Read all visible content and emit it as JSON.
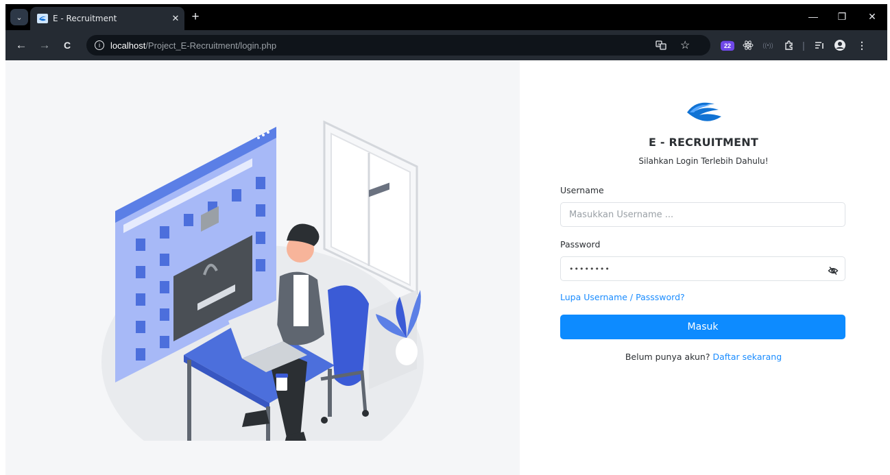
{
  "browser": {
    "tab": {
      "title": "E - Recruitment",
      "close_glyph": "✕"
    },
    "new_tab_glyph": "+",
    "window_controls": {
      "minimize": "—",
      "restore": "❐",
      "close": "✕"
    },
    "nav": {
      "back": "←",
      "forward": "→",
      "reload": "C"
    },
    "address": {
      "host": "localhost",
      "path": "/Project_E-Recruitment/login.php"
    },
    "extension_badge": "22"
  },
  "icons": {
    "tab_search": "chevron-down-icon",
    "favicon": "e-recruitment-logo-icon",
    "site_info": "info-icon",
    "translate": "translate-icon",
    "bookmark": "star-icon",
    "extensions": "puzzle-icon",
    "password_toggle": "eye-slash-icon"
  },
  "login": {
    "app_name": "E - RECRUITMENT",
    "subtitle": "Silahkan Login Terlebih Dahulu!",
    "username_label": "Username",
    "username_placeholder": "Masukkan Username ...",
    "password_label": "Password",
    "password_value": "••••••••",
    "forgot_link": "Lupa Username / Passsword?",
    "submit_label": "Masuk",
    "register_prompt": "Belum punya akun? ",
    "register_link": "Daftar sekarang"
  },
  "colors": {
    "accent": "#0d8bff",
    "link": "#1a8cff",
    "illustration_blue": "#5b7fe6",
    "illustration_lightblue": "#a7b9f7"
  }
}
